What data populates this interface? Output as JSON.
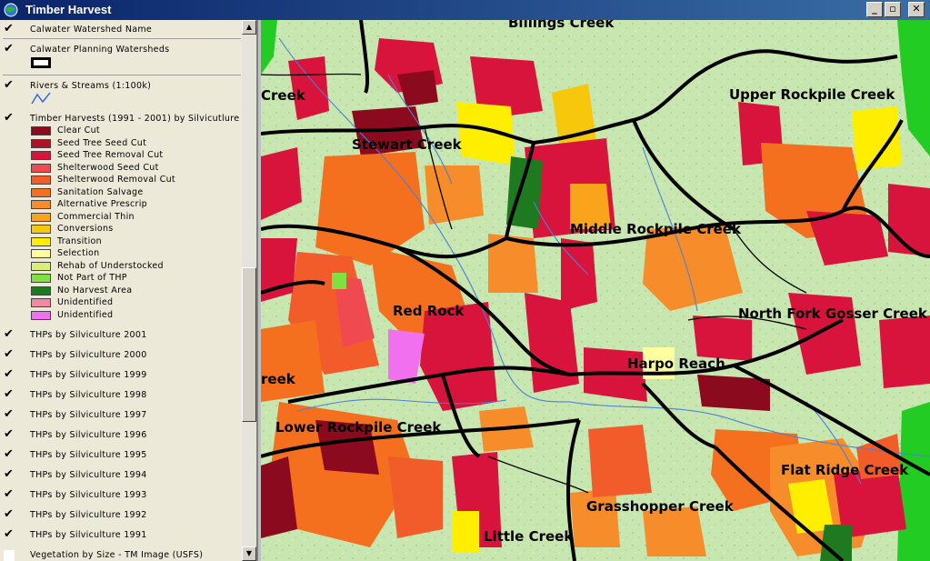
{
  "window": {
    "title": "Timber Harvest",
    "minimize_label": "_",
    "maximize_label": "▫",
    "close_label": "✕"
  },
  "toc": {
    "top_layers": [
      {
        "label": "Calwater Watershed Name",
        "checked": true
      },
      {
        "label": "Calwater Planning Watersheds",
        "checked": true
      },
      {
        "label": "Rivers & Streams (1:100k)",
        "checked": true
      },
      {
        "label": "Timber Harvests (1991 - 2001) by Silvicutlure",
        "checked": true
      }
    ],
    "legend": [
      {
        "label": "Clear Cut",
        "color": "#8b0a1e"
      },
      {
        "label": "Seed Tree Seed Cut",
        "color": "#b0102a"
      },
      {
        "label": "Seed Tree Removal Cut",
        "color": "#d8143c"
      },
      {
        "label": "Shelterwood Seed Cut",
        "color": "#f04a50"
      },
      {
        "label": "Shelterwood Removal Cut",
        "color": "#f25c2a"
      },
      {
        "label": "Sanitation Salvage",
        "color": "#f46f1e"
      },
      {
        "label": "Alternative Prescrip",
        "color": "#f78c2a"
      },
      {
        "label": "Commercial Thin",
        "color": "#f9a41a"
      },
      {
        "label": "Conversions",
        "color": "#f7c70c"
      },
      {
        "label": "Transition",
        "color": "#ffee00"
      },
      {
        "label": "Selection",
        "color": "#ffffa0"
      },
      {
        "label": "Rehab of Understocked",
        "color": "#d8f07a"
      },
      {
        "label": "Not Part of THP",
        "color": "#80e040"
      },
      {
        "label": "No Harvest Area",
        "color": "#1e7a1e"
      },
      {
        "label": "Unidentified",
        "color": "#f08aa0"
      },
      {
        "label": "Unidentified",
        "color": "#f070f0"
      }
    ],
    "thp_layers": [
      {
        "label": "THPs by Silviculture 2001",
        "checked": true
      },
      {
        "label": "THPs by Silviculture 2000",
        "checked": true
      },
      {
        "label": "THPs by Silviculture 1999",
        "checked": true
      },
      {
        "label": "THPs by Silviculture 1998",
        "checked": true
      },
      {
        "label": "THPs by Silviculture 1997",
        "checked": true
      },
      {
        "label": "THPs by Silviculture 1996",
        "checked": true
      },
      {
        "label": "THPs by Silviculture 1995",
        "checked": true
      },
      {
        "label": "THPs by Silviculture 1994",
        "checked": true
      },
      {
        "label": "THPs by Silviculture 1993",
        "checked": true
      },
      {
        "label": "THPs by Silviculture 1992",
        "checked": true
      },
      {
        "label": "THPs by Silviculture 1991",
        "checked": true
      },
      {
        "label": "Vegetation by Size - TM Image (USFS)",
        "checked": false
      }
    ]
  },
  "map": {
    "labels": [
      "Billings Creek",
      "Creek",
      "Upper Rockpile Creek",
      "Stewart Creek",
      "Middle Rockpile Creek",
      "Red Rock",
      "North Fork Gosser Creek",
      "Harpo Reach",
      "reek",
      "Lower Rockpile Creek",
      "Flat Ridge Creek",
      "Grasshopper Creek",
      "Little Creek"
    ]
  },
  "colors": {
    "titlebar": "#0a246a",
    "base_map": "#c8e6b0",
    "outside_area": "#22cc22",
    "boundary": "#000000",
    "stream": "#4a80d8"
  }
}
